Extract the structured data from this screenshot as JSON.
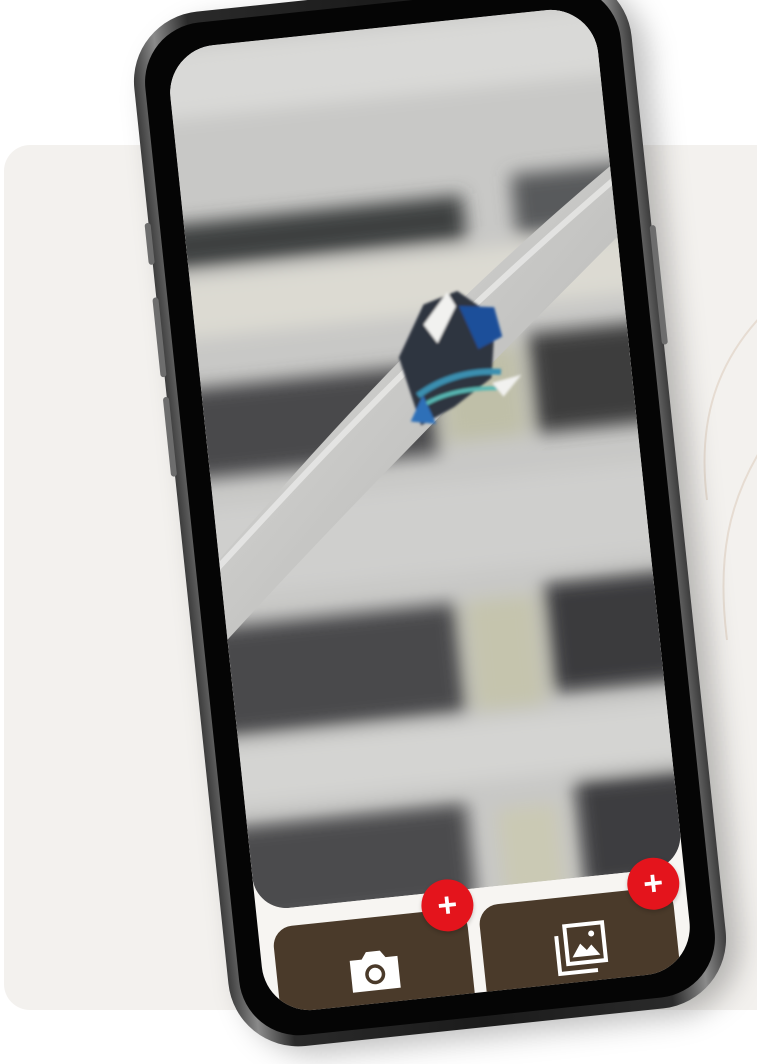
{
  "screen": {
    "photo": {
      "subject_icon": "damaged-cable-photo"
    },
    "actions": [
      {
        "icon": "camera-icon",
        "badge": "+"
      },
      {
        "icon": "gallery-icon",
        "badge": "+"
      }
    ]
  },
  "colors": {
    "action_button": "#4a3a2a",
    "badge": "#e4141c",
    "background_card": "#f3f1ee"
  }
}
